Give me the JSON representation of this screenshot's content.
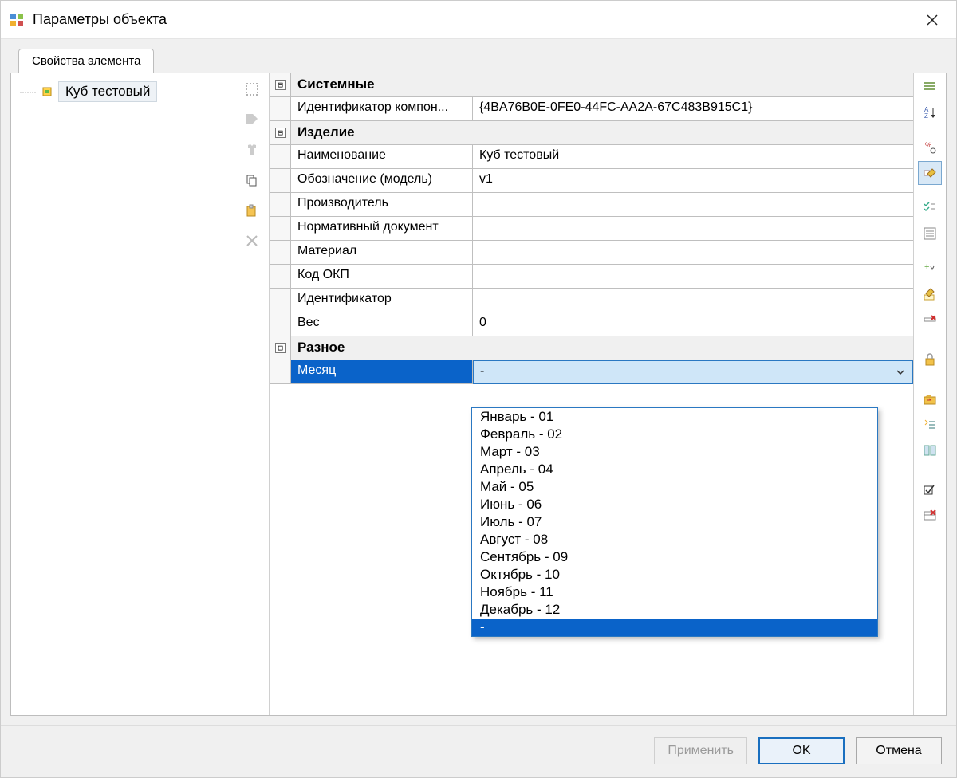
{
  "window": {
    "title": "Параметры объекта"
  },
  "tab": {
    "label": "Свойства элемента"
  },
  "tree": {
    "item": "Куб тестовый"
  },
  "categories": {
    "system": "Системные",
    "product": "Изделие",
    "misc": "Разное"
  },
  "props": {
    "component_id_label": "Идентификатор компон...",
    "component_id_value": "{4BA76B0E-0FE0-44FC-AA2A-67C483B915C1}",
    "name_label": "Наименование",
    "name_value": "Куб тестовый",
    "designation_label": "Обозначение (модель)",
    "designation_value": "v1",
    "manufacturer_label": "Производитель",
    "manufacturer_value": "",
    "normdoc_label": "Нормативный документ",
    "normdoc_value": "",
    "material_label": "Материал",
    "material_value": "",
    "okp_label": "Код ОКП",
    "okp_value": "",
    "id_label": "Идентификатор",
    "id_value": "",
    "weight_label": "Вес",
    "weight_value": "0",
    "month_label": "Месяц",
    "month_value": "-"
  },
  "dropdown": {
    "items": [
      "Январь - 01",
      "Февраль - 02",
      "Март - 03",
      "Апрель - 04",
      "Май - 05",
      "Июнь - 06",
      "Июль - 07",
      "Август - 08",
      "Сентябрь - 09",
      "Октябрь - 10",
      "Ноябрь - 11",
      "Декабрь - 12",
      "-"
    ],
    "selected": "-"
  },
  "buttons": {
    "apply": "Применить",
    "ok": "OK",
    "cancel": "Отмена"
  },
  "expander": "⊟"
}
